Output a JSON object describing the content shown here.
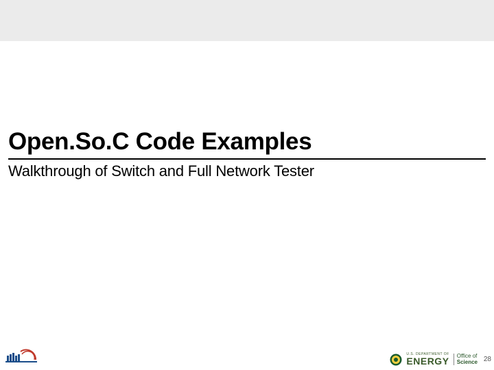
{
  "slide": {
    "title": "Open.So.C Code Examples",
    "subtitle": "Walkthrough of Switch and Full Network Tester",
    "page_number": "28"
  },
  "footer": {
    "doe": {
      "line1": "U.S. DEPARTMENT OF",
      "line2": "ENERGY"
    },
    "office": {
      "line1": "Office of",
      "line2": "Science"
    }
  },
  "colors": {
    "top_band": "#ebebeb",
    "title_rule": "#000000",
    "doe_green": "#3a5a2a"
  }
}
